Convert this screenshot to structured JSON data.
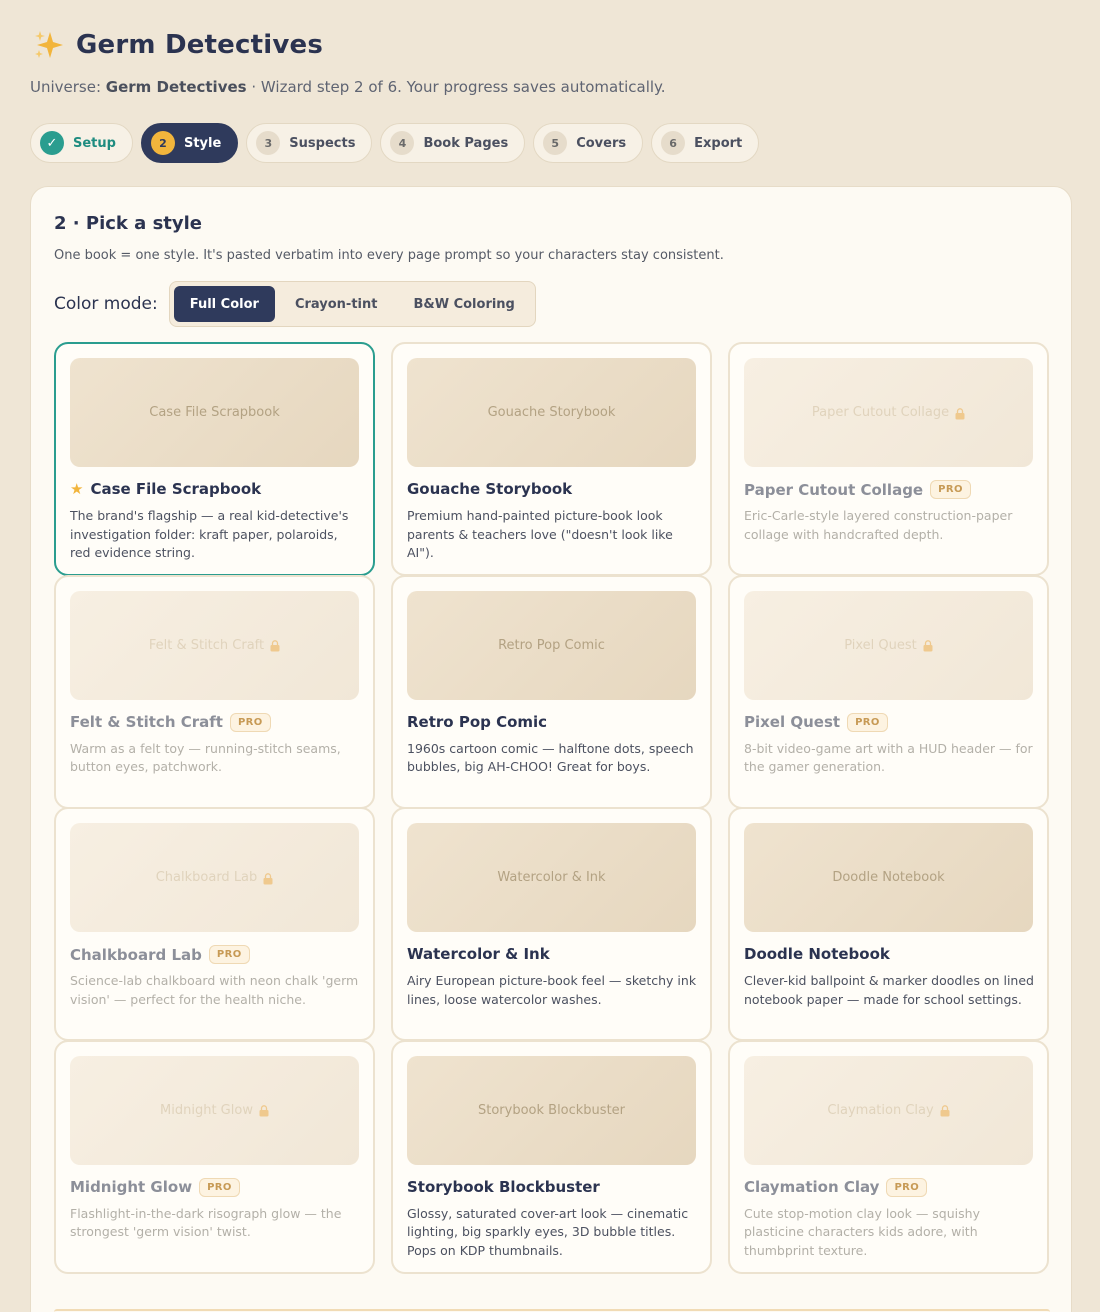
{
  "app": {
    "title": "Germ Detectives",
    "icon": "sparkle-icon"
  },
  "subtitle": {
    "prefix": "Universe: ",
    "universe": "Germ Detectives",
    "suffix": " · Wizard step 2 of 6. Your progress saves automatically."
  },
  "steps": [
    {
      "num": "✓",
      "label": "Setup",
      "state": "done"
    },
    {
      "num": "2",
      "label": "Style",
      "state": "active"
    },
    {
      "num": "3",
      "label": "Suspects",
      "state": "todo"
    },
    {
      "num": "4",
      "label": "Book Pages",
      "state": "todo"
    },
    {
      "num": "5",
      "label": "Covers",
      "state": "todo"
    },
    {
      "num": "6",
      "label": "Export",
      "state": "todo"
    }
  ],
  "panel": {
    "title": "2 · Pick a style",
    "description": "One book = one style. It's pasted verbatim into every page prompt so your characters stay consistent.",
    "color_mode_label": "Color mode:",
    "color_modes": [
      "Full Color",
      "Crayon-tint",
      "B&W Coloring"
    ],
    "selected_color_mode": "Full Color"
  },
  "colors": {
    "navy": "#2f3a5c",
    "teal": "#2a9d8f",
    "gold": "#f2b53c",
    "background": "#efe6d6"
  },
  "styles": [
    {
      "thumb": "Case File Scrapbook",
      "name": "Case File Scrapbook",
      "desc": "The brand's flagship — a real kid-detective's investigation folder: kraft paper, polaroids, red evidence string.",
      "selected": true,
      "starred": true,
      "pro": false,
      "locked": false
    },
    {
      "thumb": "Gouache Storybook",
      "name": "Gouache Storybook",
      "desc": "Premium hand-painted picture-book look parents & teachers love (\"doesn't look like AI\").",
      "selected": false,
      "starred": false,
      "pro": false,
      "locked": false
    },
    {
      "thumb": "Paper Cutout Collage",
      "name": "Paper Cutout Collage",
      "desc": "Eric-Carle-style layered construction-paper collage with handcrafted depth.",
      "selected": false,
      "starred": false,
      "pro": true,
      "locked": true
    },
    {
      "thumb": "Felt & Stitch Craft",
      "name": "Felt & Stitch Craft",
      "desc": "Warm as a felt toy — running-stitch seams, button eyes, patchwork.",
      "selected": false,
      "starred": false,
      "pro": true,
      "locked": true
    },
    {
      "thumb": "Retro Pop Comic",
      "name": "Retro Pop Comic",
      "desc": "1960s cartoon comic — halftone dots, speech bubbles, big AH-CHOO! Great for boys.",
      "selected": false,
      "starred": false,
      "pro": false,
      "locked": false
    },
    {
      "thumb": "Pixel Quest",
      "name": "Pixel Quest",
      "desc": "8-bit video-game art with a HUD header — for the gamer generation.",
      "selected": false,
      "starred": false,
      "pro": true,
      "locked": true
    },
    {
      "thumb": "Chalkboard Lab",
      "name": "Chalkboard Lab",
      "desc": "Science-lab chalkboard with neon chalk 'germ vision' — perfect for the health niche.",
      "selected": false,
      "starred": false,
      "pro": true,
      "locked": true
    },
    {
      "thumb": "Watercolor & Ink",
      "name": "Watercolor & Ink",
      "desc": "Airy European picture-book feel — sketchy ink lines, loose watercolor washes.",
      "selected": false,
      "starred": false,
      "pro": false,
      "locked": false
    },
    {
      "thumb": "Doodle Notebook",
      "name": "Doodle Notebook",
      "desc": "Clever-kid ballpoint & marker doodles on lined notebook paper — made for school settings.",
      "selected": false,
      "starred": false,
      "pro": false,
      "locked": false
    },
    {
      "thumb": "Midnight Glow",
      "name": "Midnight Glow",
      "desc": "Flashlight-in-the-dark risograph glow — the strongest 'germ vision' twist.",
      "selected": false,
      "starred": false,
      "pro": true,
      "locked": true
    },
    {
      "thumb": "Storybook Blockbuster",
      "name": "Storybook Blockbuster",
      "desc": "Glossy, saturated cover-art look — cinematic lighting, big sparkly eyes, 3D bubble titles. Pops on KDP thumbnails.",
      "selected": false,
      "starred": false,
      "pro": false,
      "locked": false
    },
    {
      "thumb": "Claymation Clay",
      "name": "Claymation Clay",
      "desc": "Cute stop-motion clay look — squishy plasticine characters kids adore, with thumbprint texture.",
      "selected": false,
      "starred": false,
      "pro": true,
      "locked": true
    }
  ],
  "labels": {
    "pro": "PRO",
    "star": "★"
  }
}
